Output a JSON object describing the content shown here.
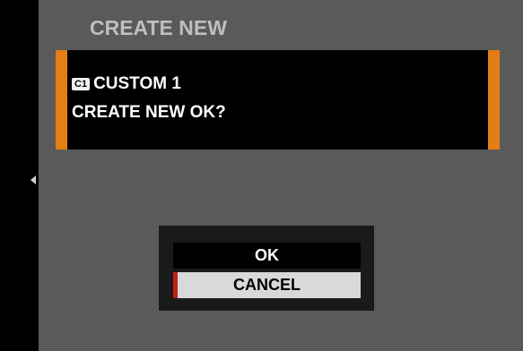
{
  "screen": {
    "title": "CREATE NEW"
  },
  "message": {
    "profile_icon": "C1",
    "profile_name": "CUSTOM 1",
    "question": "CREATE NEW OK?"
  },
  "dialog": {
    "options": [
      {
        "label": "OK",
        "selected": false
      },
      {
        "label": "CANCEL",
        "selected": true
      }
    ]
  },
  "colors": {
    "accent": "#e47d12",
    "cursor": "#c02018",
    "background": "#5a5a5a"
  }
}
